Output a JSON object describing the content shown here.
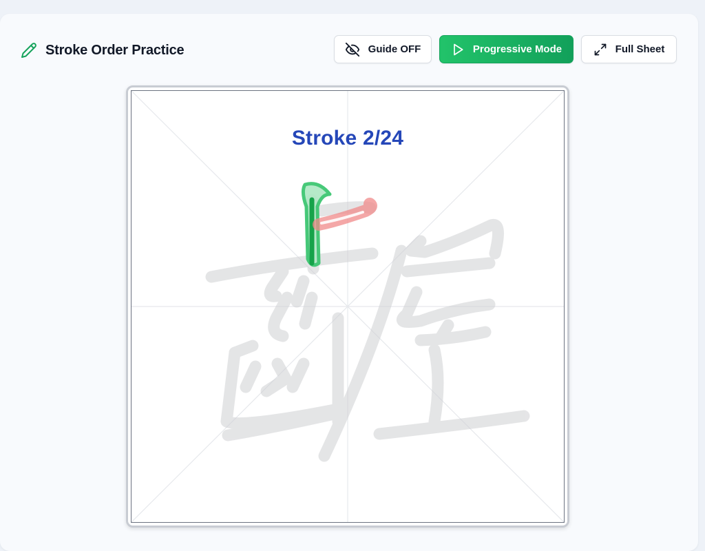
{
  "header": {
    "title": "Stroke Order Practice",
    "icon": "pencil-icon"
  },
  "toolbar": {
    "guide_label": "Guide OFF",
    "guide_icon": "eye-off-icon",
    "progressive_label": "Progressive Mode",
    "progressive_icon": "play-icon",
    "full_sheet_label": "Full Sheet",
    "full_sheet_icon": "expand-icon"
  },
  "canvas": {
    "stroke_counter": "Stroke 2/24",
    "current_stroke": 2,
    "total_strokes": 24,
    "character": "齷",
    "colors": {
      "completed_stroke": "#34c46b",
      "completed_stroke_center": "#16a34a",
      "next_stroke_hint": "#f08a8a",
      "guide_character": "#c9cacd",
      "grid_lines": "#e5e7eb",
      "counter_text": "#2547b8"
    }
  },
  "theme": {
    "accent": "#16a35c",
    "page_bg": "#eef2f8",
    "card_bg": "#f8fafd"
  }
}
